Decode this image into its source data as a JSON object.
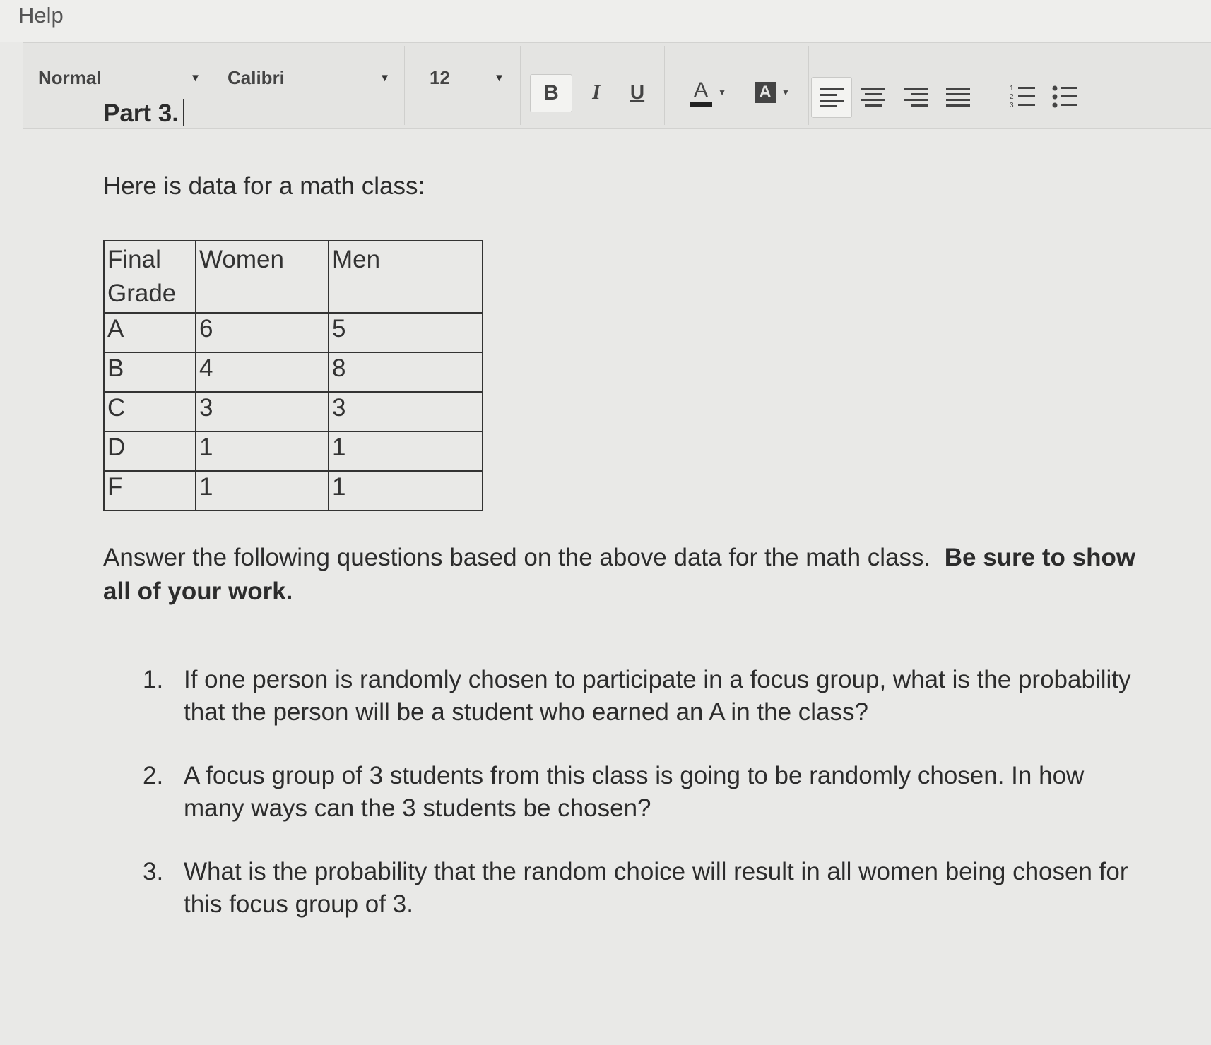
{
  "menu": {
    "help": "Help"
  },
  "toolbar": {
    "style": "Normal",
    "font": "Calibri",
    "size": "12",
    "bold": "B",
    "italic": "I",
    "underline": "U",
    "font_color": "A",
    "highlight": "A"
  },
  "document": {
    "part_title": "Part 3.",
    "intro": "Here is data for a math class:",
    "table": {
      "headers": [
        "Final Grade",
        "Women",
        "Men"
      ],
      "rows": [
        [
          "A",
          "6",
          "5"
        ],
        [
          "B",
          "4",
          "8"
        ],
        [
          "C",
          "3",
          "3"
        ],
        [
          "D",
          "1",
          "1"
        ],
        [
          "F",
          "1",
          "1"
        ]
      ]
    },
    "instructions": "Answer the following questions based on the above data for the math class.",
    "instructions_bold": "Be sure to show all of your work.",
    "questions": [
      {
        "num": "1.",
        "text": "If one person is randomly chosen to participate in a focus group, what is the probability that the person will be a student who earned an A in the class?"
      },
      {
        "num": "2.",
        "text": "A focus group of 3 students from this class is going to be randomly chosen.  In how many ways can the 3 students be chosen?"
      },
      {
        "num": "3.",
        "text": "What is the probability that the random choice will result in all women being chosen for this focus group of 3."
      }
    ]
  }
}
